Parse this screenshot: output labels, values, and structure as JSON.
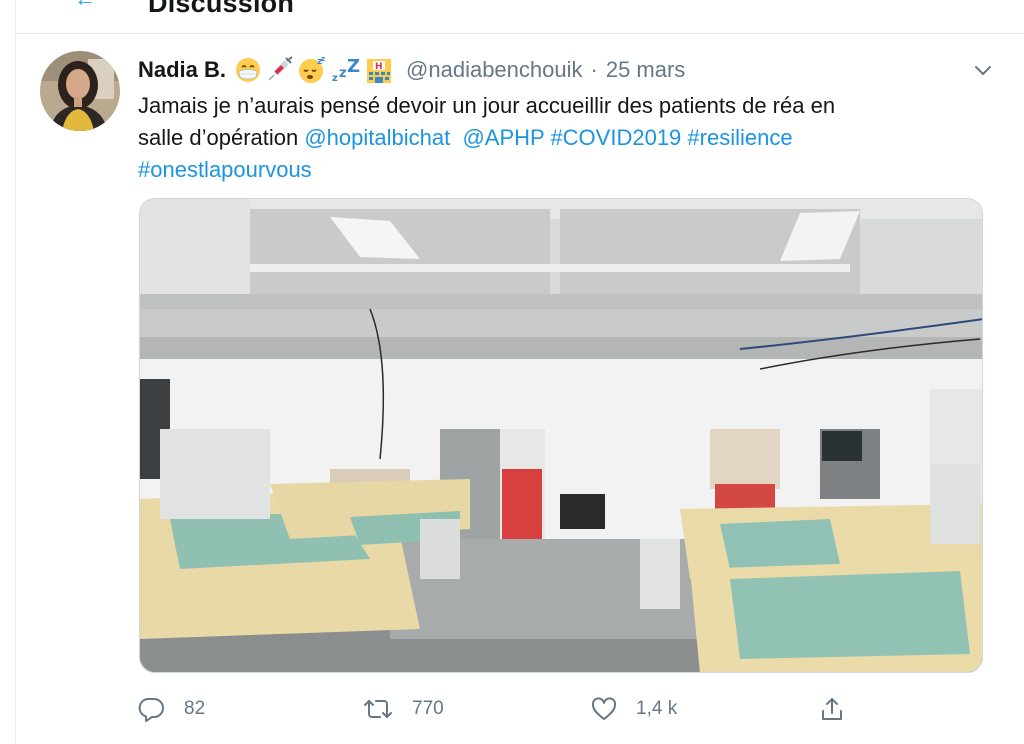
{
  "header": {
    "title": "Discussion"
  },
  "tweet": {
    "author": {
      "display_name": "Nadia B.",
      "emojis": [
        "face-with-medical-mask-icon",
        "syringe-icon",
        "sleeping-face-icon",
        "zzz-icon",
        "hospital-icon"
      ],
      "handle": "@nadiabenchouik"
    },
    "separator": "·",
    "date": "25 mars",
    "text": {
      "line1": "Jamais je n’aurais pensé devoir un jour accueillir des patients de réa en",
      "line2_prefix": "salle d’opération ",
      "mention1": "@hopitalbichat",
      "mention2": "@APHP",
      "hashtag1": "#COVID2019",
      "hashtag2": "#resilience",
      "hashtag3": "#onestlapourvous"
    },
    "media": {
      "description_icon": "photo-hospital-operating-room"
    },
    "actions": {
      "reply_count": "82",
      "retweet_count": "770",
      "like_count": "1,4 k"
    }
  },
  "colors": {
    "link": "#1b95e0",
    "secondary_text": "#657786",
    "primary_text": "#14171a"
  }
}
